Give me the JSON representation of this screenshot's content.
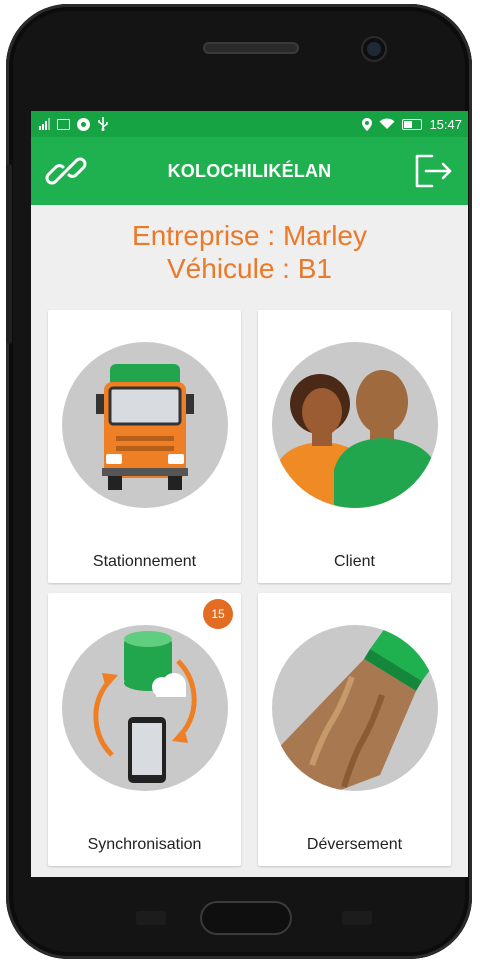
{
  "status_bar": {
    "time": "15:47",
    "left_icons": [
      "signal-icon",
      "image-icon",
      "app-icon",
      "usb-icon"
    ],
    "right_icons": [
      "location-icon",
      "wifi-icon",
      "battery-icon"
    ]
  },
  "toolbar": {
    "title": "KOLOCHILIKÉLAN",
    "left_icon": "link-icon",
    "right_icon": "logout-icon"
  },
  "header": {
    "entreprise": "Entreprise : Marley",
    "vehicule": "Véhicule : B1"
  },
  "tiles": [
    {
      "label": "Stationnement",
      "icon": "truck-icon"
    },
    {
      "label": "Client",
      "icon": "clients-icon"
    },
    {
      "label": "Synchronisation",
      "icon": "sync-icon",
      "badge": "15"
    },
    {
      "label": "Déversement",
      "icon": "pouring-icon"
    }
  ],
  "colors": {
    "toolbar": "#1fb14f",
    "status_bar": "#16a344",
    "accent": "#ea7a2a",
    "badge": "#e36c23"
  }
}
